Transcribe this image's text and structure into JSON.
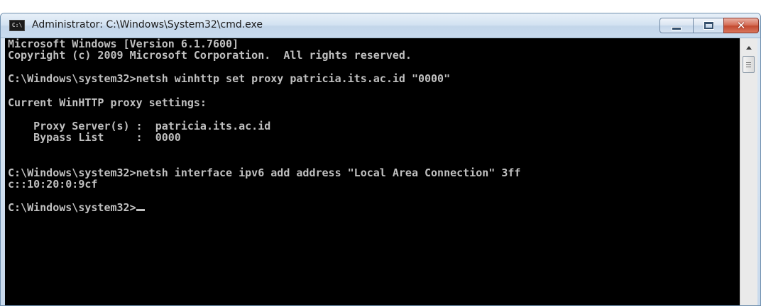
{
  "window": {
    "title": "Administrator: C:\\Windows\\System32\\cmd.exe",
    "icon_text": "C:\\",
    "controls": {
      "minimize": "minimize",
      "maximize": "maximize",
      "close": "✕"
    }
  },
  "console": {
    "lines": [
      "Microsoft Windows [Version 6.1.7600]",
      "Copyright (c) 2009 Microsoft Corporation.  All rights reserved.",
      "C:\\Windows\\system32>netsh winhttp set proxy patricia.its.ac.id \"0000\"",
      "Current WinHTTP proxy settings:",
      "    Proxy Server(s) :  patricia.its.ac.id",
      "    Bypass List     :  0000",
      "C:\\Windows\\system32>netsh interface ipv6 add address \"Local Area Connection\" 3ff",
      "c::10:20:0:9cf",
      "C:\\Windows\\system32>"
    ]
  },
  "colors": {
    "console_background": "#000000",
    "console_text": "#c0c0c0",
    "close_button": "#c84f35"
  }
}
